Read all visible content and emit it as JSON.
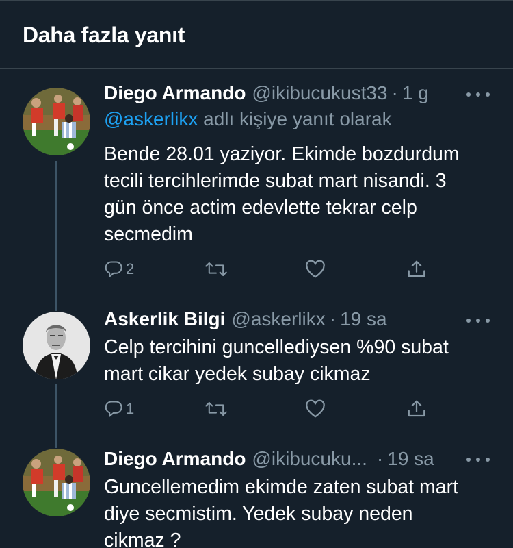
{
  "header": {
    "title": "Daha fazla yanıt"
  },
  "tweets": [
    {
      "name": "Diego Armando",
      "handle": "@ikibucukust33",
      "separator": "·",
      "time": "1 g",
      "reply_to": {
        "mention": "@askerlikx",
        "suffix": " adlı kişiye yanıt olarak"
      },
      "lines": [
        "Bende 28.01 yaziyor. Ekimde bozdurdum",
        "tecili tercihlerimde subat mart nisandi. 3",
        "gün önce actim edevlette tekrar celp",
        "secmedim"
      ],
      "reply_count": "2",
      "avatar": "football-photo"
    },
    {
      "name": "Askerlik Bilgi",
      "handle": "@askerlikx",
      "separator": "·",
      "time": "19 sa",
      "lines": [
        "Celp tercihini guncellediysen %90 subat",
        "mart cikar yedek subay cikmaz"
      ],
      "reply_count": "1",
      "avatar": "portrait-photo"
    },
    {
      "name": "Diego Armando",
      "handle": "@ikibucuku...",
      "separator": "·",
      "time": "19 sa",
      "lines": [
        "Guncellemedim ekimde zaten subat mart",
        "diye secmistim. Yedek subay neden",
        "cikmaz ?"
      ],
      "avatar": "football-photo"
    }
  ],
  "icons": {
    "reply": "reply-icon",
    "retweet": "retweet-icon",
    "like": "like-icon",
    "share": "share-icon",
    "more": "more-icon"
  },
  "colors": {
    "background": "#15202b",
    "border": "#38444d",
    "secondary_text": "#8899a6",
    "mention": "#1da1f2",
    "thread_line": "#3d5466"
  }
}
